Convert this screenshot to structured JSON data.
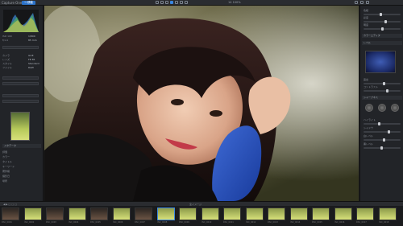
{
  "toolbar": {
    "app_title": "Capture One 23",
    "active_tab": "→ 移動",
    "zoom_label": "14 100%",
    "tools": [
      "hand-tool",
      "crop-tool",
      "rotate-tool",
      "brush-tool",
      "eraser-tool",
      "picker-tool",
      "compare-tool"
    ],
    "accent_color": "#2d73c9"
  },
  "left_panel": {
    "rows": [
      {
        "label": "ISO 100",
        "value": "1/800"
      },
      {
        "label": "f/1.4",
        "value": "85 mm"
      },
      {
        "label": "カメラ",
        "value": "ILCE"
      },
      {
        "label": "レンズ",
        "value": "FE 85"
      },
      {
        "label": "スタイル",
        "value": "Standard"
      },
      {
        "label": "ファイル",
        "value": "RAW"
      }
    ],
    "section_label": "メタデータ",
    "meta_rows": [
      "評価",
      "カラー",
      "タイトル",
      "キーワード",
      "著作権",
      "撮影日",
      "場所"
    ]
  },
  "right_panel": {
    "section_1": "カラーエディタ",
    "section_2": "レベル",
    "section_3": "シャープネス",
    "slider_labels": [
      "色相",
      "彩度",
      "明度",
      "露出",
      "コントラスト",
      "ハイライト",
      "シャドウ",
      "白レベル",
      "黒レベル"
    ]
  },
  "filmstrip": {
    "left_label": "◀ ▶ □ □ □",
    "center_label": "全イメージ",
    "frames": [
      "DSC_0001",
      "DSC_0002",
      "DSC_0003",
      "DSC_0004",
      "DSC_0005",
      "DSC_0006",
      "DSC_0007",
      "DSC_0008",
      "DSC_0009",
      "DSC_0010",
      "DSC_0011",
      "DSC_0012",
      "DSC_0013",
      "DSC_0014",
      "DSC_0015",
      "DSC_0016",
      "DSC_0017",
      "DSC_0018"
    ]
  }
}
